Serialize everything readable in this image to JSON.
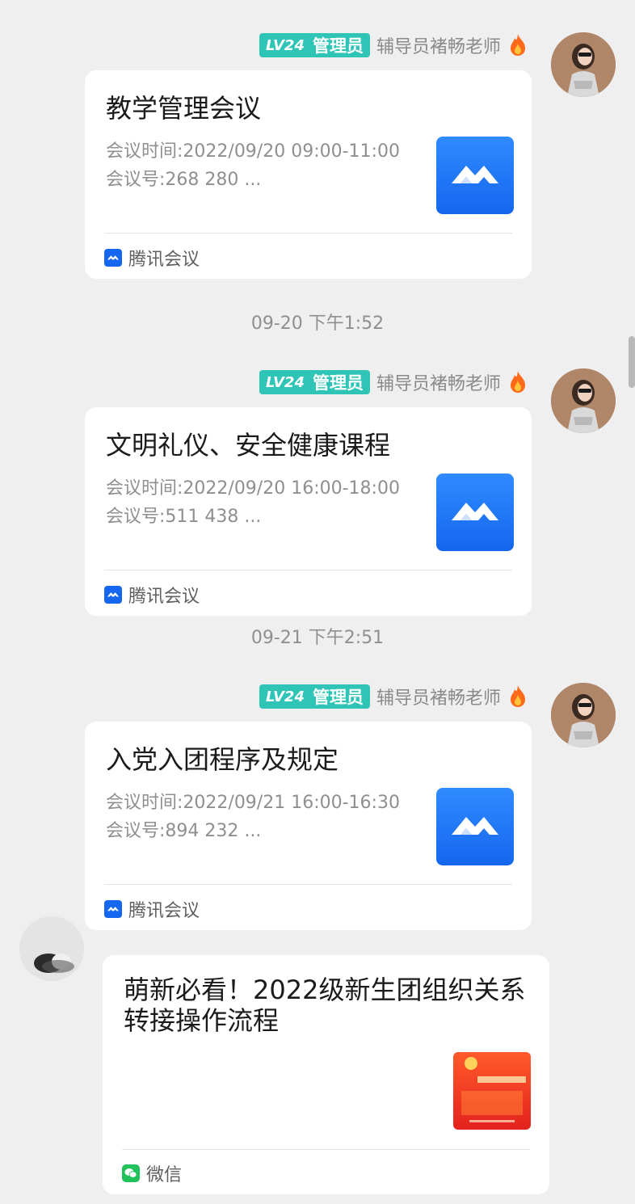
{
  "sender": {
    "level": "LV24",
    "role": "管理员",
    "name": "辅导员褚畅老师"
  },
  "messages": [
    {
      "title": "教学管理会议",
      "time_line": "会议时间:2022/09/20 09:00-11:00",
      "id_line": "会议号:268 280 ...",
      "source": "腾讯会议"
    },
    {
      "title": "文明礼仪、安全健康课程",
      "time_line": "会议时间:2022/09/20 16:00-18:00",
      "id_line": "会议号:511 438 ...",
      "source": "腾讯会议"
    },
    {
      "title": "入党入团程序及规定",
      "time_line": "会议时间:2022/09/21 16:00-16:30",
      "id_line": "会议号:894 232 ...",
      "source": "腾讯会议"
    }
  ],
  "timestamps": [
    "09-20 下午1:52",
    "09-21 下午2:51"
  ],
  "article": {
    "title": "萌新必看！2022级新生团组织关系转接操作流程",
    "source": "微信"
  },
  "colors": {
    "badge": "#2ec4b6",
    "meeting_blue": "#1467ee",
    "wechat_green": "#21c25a",
    "background": "#efefef"
  },
  "icons": {
    "meeting": "tencent-meeting-icon",
    "wechat": "wechat-icon",
    "fire": "fire-icon"
  }
}
